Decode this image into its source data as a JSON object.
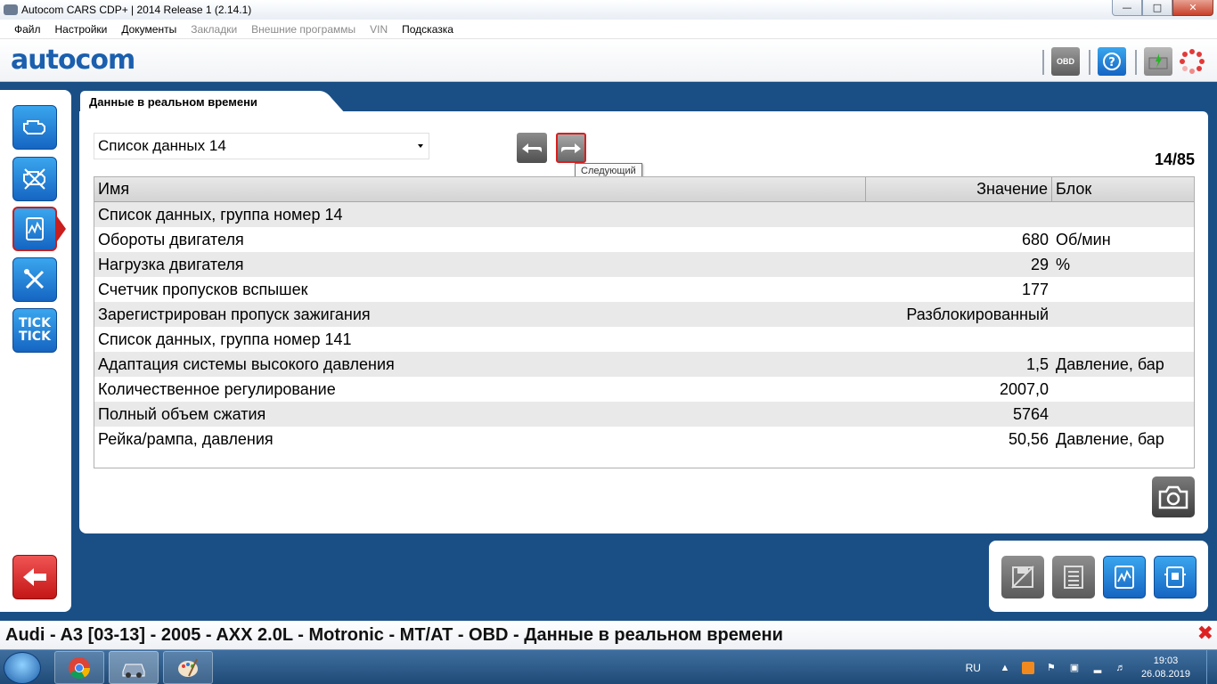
{
  "window": {
    "title": "Autocom CARS CDP+ | 2014 Release 1 (2.14.1)"
  },
  "menu": {
    "items": [
      {
        "label": "Файл",
        "enabled": true
      },
      {
        "label": "Настройки",
        "enabled": true
      },
      {
        "label": "Документы",
        "enabled": true
      },
      {
        "label": "Закладки",
        "enabled": false
      },
      {
        "label": "Внешние программы",
        "enabled": false
      },
      {
        "label": "VIN",
        "enabled": false
      },
      {
        "label": "Подсказка",
        "enabled": true
      }
    ]
  },
  "toolbar": {
    "logo": "autocom",
    "obd_label": "OBD"
  },
  "sidebar": {
    "tick_label": "TICK TICK"
  },
  "tab": {
    "label": "Данные в реальном времени"
  },
  "list_select": {
    "value": "Список данных 14"
  },
  "navigation": {
    "tooltip": "Следующий"
  },
  "counter": "14/85",
  "table": {
    "headers": {
      "name": "Имя",
      "value": "Значение",
      "unit": "Блок"
    },
    "rows": [
      {
        "name": "Список данных, группа номер 14",
        "value": "",
        "unit": ""
      },
      {
        "name": "Обороты двигателя",
        "value": "680",
        "unit": "Об/мин"
      },
      {
        "name": "Нагрузка двигателя",
        "value": "29",
        "unit": "%"
      },
      {
        "name": "Счетчик пропусков вспышек",
        "value": "177",
        "unit": ""
      },
      {
        "name": "Зарегистрирован пропуск зажигания",
        "value": "Разблокированный",
        "unit": ""
      },
      {
        "name": "Список данных, группа номер 141",
        "value": "",
        "unit": ""
      },
      {
        "name": "Адаптация системы высокого давления",
        "value": "1,5",
        "unit": "Давление, бар"
      },
      {
        "name": "Количественное регулирование",
        "value": "2007,0",
        "unit": ""
      },
      {
        "name": "Полный объем сжатия",
        "value": "5764",
        "unit": ""
      },
      {
        "name": "Рейка/рампа, давления",
        "value": "50,56",
        "unit": "Давление, бар"
      }
    ]
  },
  "status": {
    "text": "Audi - A3 [03-13] - 2005 - AXX 2.0L - Motronic - MT/AT - OBD - Данные в реальном времени"
  },
  "taskbar": {
    "language": "RU",
    "time": "19:03",
    "date": "26.08.2019"
  },
  "colors": {
    "accent_blue": "#1b5fae",
    "active_red": "#c81e1e",
    "bg_blue": "#1a4f86"
  }
}
